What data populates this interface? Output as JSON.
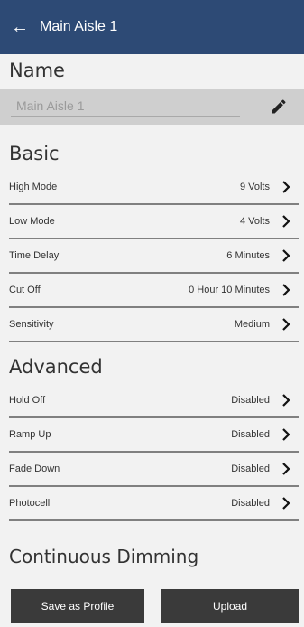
{
  "header": {
    "back_icon": "arrow-left-icon",
    "title": "Main Aisle 1"
  },
  "name_section": {
    "title": "Name",
    "name_value": "Main Aisle 1",
    "edit_icon": "pencil-icon"
  },
  "basic": {
    "title": "Basic",
    "rows": [
      {
        "label": "High Mode",
        "value": "9 Volts"
      },
      {
        "label": "Low Mode",
        "value": "4 Volts"
      },
      {
        "label": "Time Delay",
        "value": "6 Minutes"
      },
      {
        "label": "Cut Off",
        "value": "0 Hour 10 Minutes"
      },
      {
        "label": "Sensitivity",
        "value": "Medium"
      }
    ]
  },
  "advanced": {
    "title": "Advanced",
    "rows": [
      {
        "label": "Hold Off",
        "value": "Disabled"
      },
      {
        "label": "Ramp Up",
        "value": "Disabled"
      },
      {
        "label": "Fade Down",
        "value": "Disabled"
      },
      {
        "label": "Photocell",
        "value": "Disabled"
      }
    ]
  },
  "continuous": {
    "title": "Continuous Dimming"
  },
  "footer": {
    "save_label": "Save as Profile",
    "upload_label": "Upload"
  },
  "colors": {
    "header": "#2d4a75",
    "button": "#3a3a3a",
    "name_row": "#cfcfcf"
  }
}
